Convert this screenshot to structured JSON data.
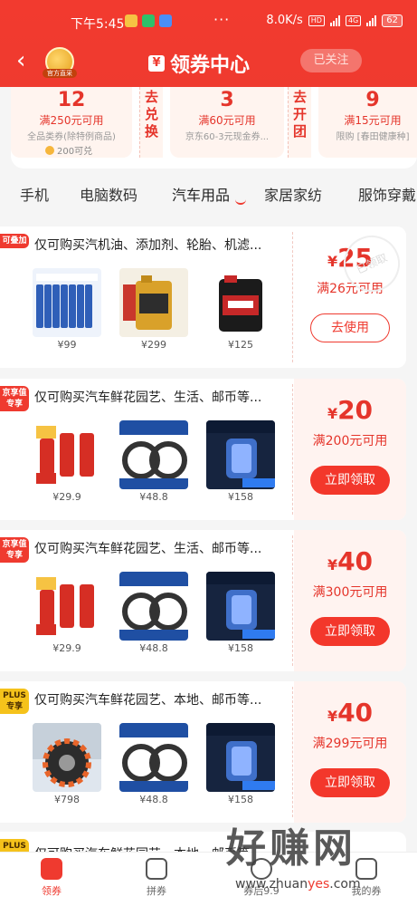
{
  "status": {
    "time": "下午5:45",
    "dots": "···",
    "speed": "8.0K/s",
    "hd": "HD",
    "net1": "4G",
    "net2": "4G",
    "battery": "62"
  },
  "nav": {
    "back": "‹",
    "badge": "官方直采",
    "title": "领券中心",
    "title_icon": "¥",
    "follow": "已关注"
  },
  "top_coupons": [
    {
      "amount": "12",
      "cond": "满250元可用",
      "desc": "全品类券(除特例商品)",
      "extra": "200可兑"
    },
    {
      "side": "去兑换"
    },
    {
      "amount": "3",
      "cond": "满60元可用",
      "desc": "京东60-3元现金券..."
    },
    {
      "side": "去开团"
    },
    {
      "amount": "9",
      "cond": "满15元可用",
      "desc": "限购 [春田健康种]"
    }
  ],
  "categories": [
    "手机",
    "电脑数码",
    "汽车用品",
    "家居家纺",
    "服饰穿戴"
  ],
  "active_category": "汽车用品",
  "cards": [
    {
      "tag": "可叠加",
      "title": "仅可购买汽机油、添加剂、轮胎、机滤...",
      "products": [
        {
          "price": "¥99"
        },
        {
          "price": "¥299"
        },
        {
          "price": "¥125"
        }
      ],
      "currency": "¥",
      "amount": "25",
      "cond": "满26元可用",
      "button": "去使用",
      "stamp": "已领取"
    },
    {
      "tag": "京享值专享",
      "title": "仅可购买汽车鲜花园艺、生活、邮币等...",
      "products": [
        {
          "price": "¥29.9"
        },
        {
          "price": "¥48.8"
        },
        {
          "price": "¥158"
        }
      ],
      "currency": "¥",
      "amount": "20",
      "cond": "满200元可用",
      "button": "立即领取"
    },
    {
      "tag": "京享值专享",
      "title": "仅可购买汽车鲜花园艺、生活、邮币等...",
      "products": [
        {
          "price": "¥29.9"
        },
        {
          "price": "¥48.8"
        },
        {
          "price": "¥158"
        }
      ],
      "currency": "¥",
      "amount": "40",
      "cond": "满300元可用",
      "button": "立即领取"
    },
    {
      "tag": "PLUS专享",
      "title": "仅可购买汽车鲜花园艺、本地、邮币等...",
      "products": [
        {
          "price": "¥798"
        },
        {
          "price": "¥48.8"
        },
        {
          "price": "¥158"
        }
      ],
      "currency": "¥",
      "amount": "40",
      "cond": "满299元可用",
      "button": "立即领取"
    },
    {
      "tag": "PLUS专享",
      "title": "仅可购买汽车鲜花园艺、本地、邮币等..."
    }
  ],
  "bottom_nav": [
    {
      "label": "领券"
    },
    {
      "label": "拼券"
    },
    {
      "label": "券后9.9"
    },
    {
      "label": "我的券"
    }
  ],
  "watermark": {
    "text": "好赚网",
    "url_prefix": "www.zhuan",
    "url_mid": "yes",
    "url_suffix": ".com"
  },
  "colors": {
    "brand_red": "#ef3a2f",
    "plus_yellow": "#f5c21b"
  }
}
